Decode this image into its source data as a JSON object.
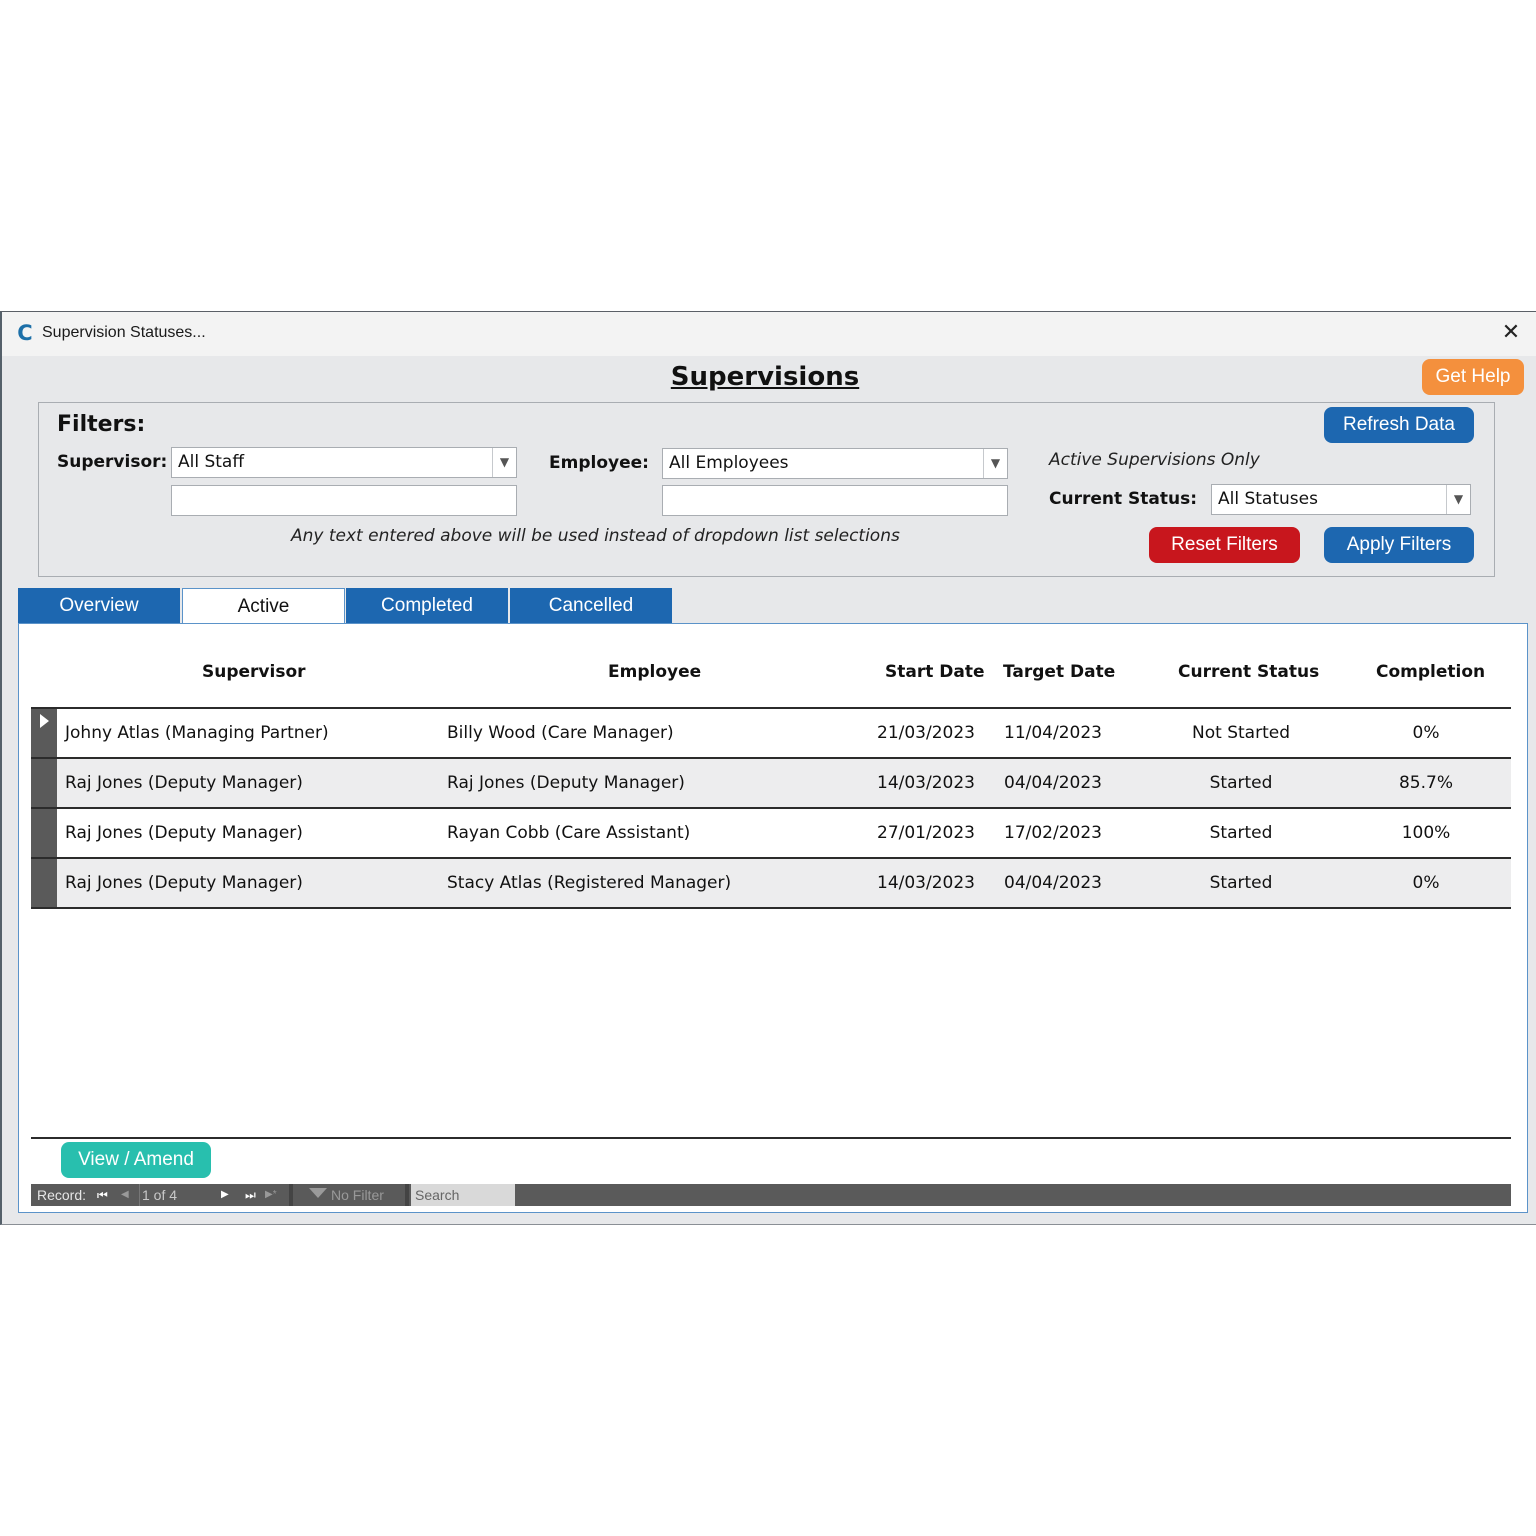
{
  "window": {
    "title": "Supervision Statuses...",
    "close_glyph": "✕",
    "app_icon_glyph": "C"
  },
  "header": {
    "page_title": "Supervisions",
    "get_help_label": "Get Help"
  },
  "filters": {
    "heading": "Filters:",
    "supervisor_label": "Supervisor:",
    "supervisor_value": "All Staff",
    "supervisor_text": "",
    "employee_label": "Employee:",
    "employee_value": "All Employees",
    "employee_text": "",
    "note": "Any text entered above will be used instead of dropdown list selections",
    "active_only_note": "Active Supervisions Only",
    "status_label": "Current Status:",
    "status_value": "All Statuses",
    "refresh_label": "Refresh Data",
    "reset_label": "Reset Filters",
    "apply_label": "Apply Filters"
  },
  "tabs": [
    {
      "label": "Overview",
      "active": false
    },
    {
      "label": "Active",
      "active": true
    },
    {
      "label": "Completed",
      "active": false
    },
    {
      "label": "Cancelled",
      "active": false
    }
  ],
  "table": {
    "columns": [
      "Supervisor",
      "Employee",
      "Start Date",
      "Target Date",
      "Current Status",
      "Completion"
    ],
    "rows": [
      {
        "supervisor": "Johny Atlas (Managing Partner)",
        "employee": "Billy Wood (Care Manager)",
        "start": "21/03/2023",
        "target": "11/04/2023",
        "status": "Not Started",
        "completion": "0%"
      },
      {
        "supervisor": "Raj Jones (Deputy Manager)",
        "employee": "Raj Jones (Deputy Manager)",
        "start": "14/03/2023",
        "target": "04/04/2023",
        "status": "Started",
        "completion": "85.7%"
      },
      {
        "supervisor": "Raj Jones (Deputy Manager)",
        "employee": "Rayan Cobb (Care Assistant)",
        "start": "27/01/2023",
        "target": "17/02/2023",
        "status": "Started",
        "completion": "100%"
      },
      {
        "supervisor": "Raj Jones (Deputy Manager)",
        "employee": "Stacy Atlas (Registered Manager)",
        "start": "14/03/2023",
        "target": "04/04/2023",
        "status": "Started",
        "completion": "0%"
      }
    ]
  },
  "footer": {
    "view_amend_label": "View / Amend",
    "record_label": "Record:",
    "record_position": "1 of 4",
    "no_filter_label": "No Filter",
    "search_placeholder": "Search",
    "first_glyph": "⏮",
    "prev_glyph": "◀",
    "next_glyph": "▶",
    "last_glyph": "⏭",
    "new_glyph": "▶*"
  },
  "colors": {
    "accent_blue": "#1d67b0",
    "help_orange": "#f4903d",
    "reset_red": "#c8161d",
    "view_teal": "#28bfae"
  }
}
